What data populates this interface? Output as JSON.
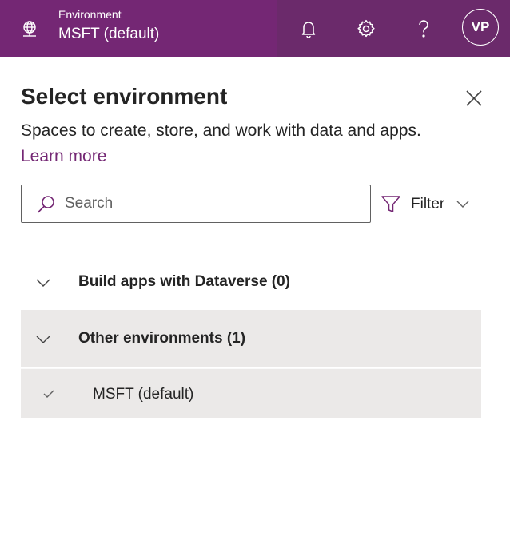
{
  "header": {
    "env_label": "Environment",
    "env_name": "MSFT (default)",
    "icons": [
      "globe-icon",
      "bell-icon",
      "gear-icon",
      "help-icon"
    ],
    "avatar_initials": "VP",
    "brand_color": "#742774"
  },
  "panel": {
    "title": "Select environment",
    "description": "Spaces to create, store, and work with data and apps.",
    "learn_more": "Learn more",
    "search_placeholder": "Search",
    "filter_label": "Filter",
    "groups": [
      {
        "label": "Build apps with Dataverse (0)",
        "expanded": false
      },
      {
        "label": "Other environments (1)",
        "expanded": true,
        "items": [
          {
            "label": "MSFT (default)",
            "selected": true
          }
        ]
      }
    ]
  }
}
